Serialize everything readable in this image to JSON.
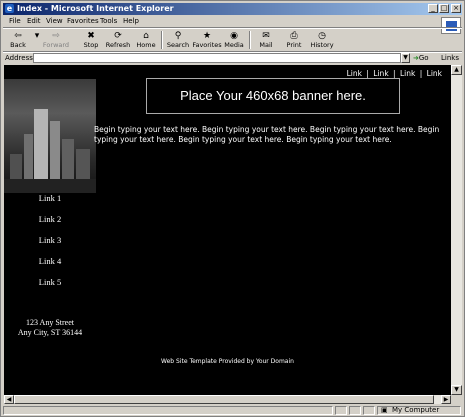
{
  "window": {
    "title": "Index - Microsoft Internet Explorer"
  },
  "menubar": {
    "items": [
      "File",
      "Edit",
      "View",
      "Favorites",
      "Tools",
      "Help"
    ]
  },
  "toolbar": {
    "back": "Back",
    "forward": "Forward",
    "stop": "Stop",
    "refresh": "Refresh",
    "home": "Home",
    "search": "Search",
    "favorites": "Favorites",
    "media": "Media",
    "mail": "Mail",
    "print": "Print",
    "history": "History"
  },
  "addressbar": {
    "label": "Address",
    "value": "",
    "go": "Go",
    "links": "Links"
  },
  "page": {
    "top_links": [
      "Link",
      "Link",
      "Link",
      "Link"
    ],
    "top_links_sep": "|",
    "banner": "Place Your 460x68 banner here.",
    "body_text": "Begin typing your text here. Begin typing your text here. Begin typing your text here. Begin typing your text here. Begin typing your text here. Begin typing your text here.",
    "side_links": [
      "Link 1",
      "Link 2",
      "Link 3",
      "Link 4",
      "Link 5"
    ],
    "address_line1": "123 Any Street",
    "address_line2": "Any City, ST 36144",
    "footer": "Web Site Template Provided by Your Domain"
  },
  "statusbar": {
    "zone": "My Computer"
  },
  "colors": {
    "titlebar_start": "#0a246a",
    "titlebar_end": "#a6caf0",
    "page_bg": "#000000",
    "page_text": "#ffffff",
    "chrome": "#d4d0c8"
  }
}
